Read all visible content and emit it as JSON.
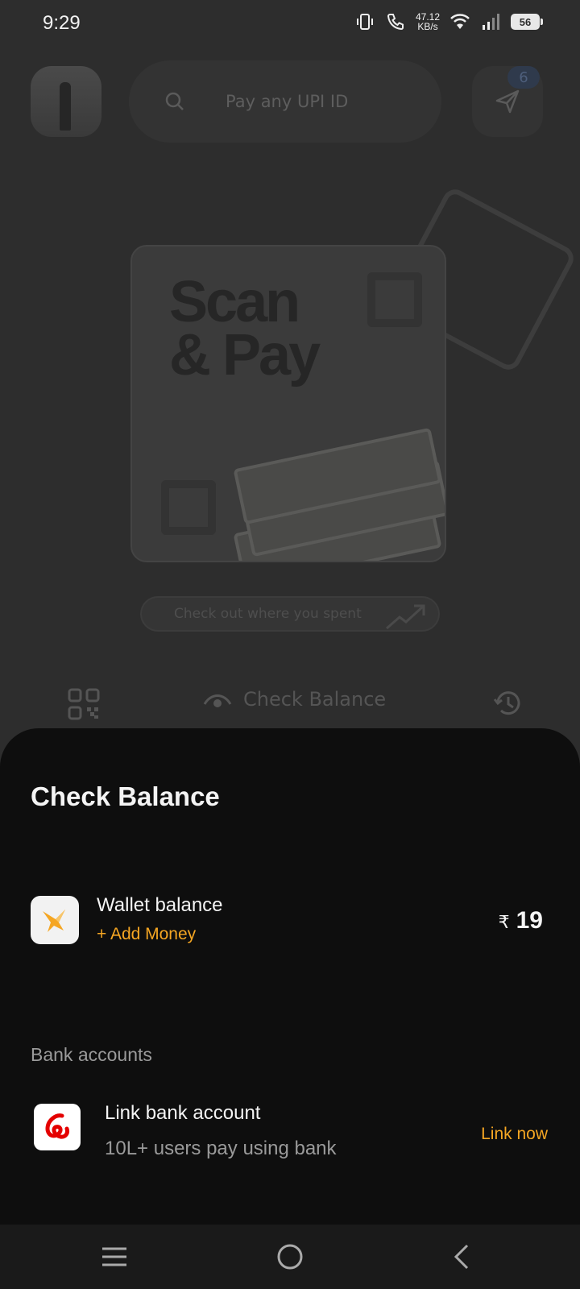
{
  "status_bar": {
    "time": "9:29",
    "net_speed_value": "47.12",
    "net_speed_unit": "KB/s",
    "battery": "56"
  },
  "header": {
    "search_placeholder": "Pay any UPI ID",
    "notification_count": "6"
  },
  "banner": {
    "title_line1": "Scan",
    "title_line2": "& Pay"
  },
  "spent_link": "Check out where you spent",
  "action_row": {
    "check_balance_label": "Check Balance"
  },
  "sheet": {
    "title": "Check Balance",
    "wallet": {
      "label": "Wallet balance",
      "add_money": "+ Add Money",
      "currency": "₹",
      "amount": "19"
    },
    "bank_section": {
      "header": "Bank accounts",
      "title": "Link bank account",
      "subtitle": "10L+ users pay using bank",
      "action": "Link now"
    }
  },
  "colors": {
    "accent": "#f5a623",
    "sheet_bg": "#0e0e0e",
    "bank_logo_red": "#e40000"
  },
  "icons": [
    "vibrate-icon",
    "call-icon",
    "wifi-icon",
    "signal-icon",
    "battery-icon",
    "search-icon",
    "send-icon",
    "qr-icon",
    "eye-icon",
    "history-icon",
    "wallet-logo-icon",
    "airtel-logo-icon",
    "menu-icon",
    "home-icon",
    "back-icon"
  ]
}
